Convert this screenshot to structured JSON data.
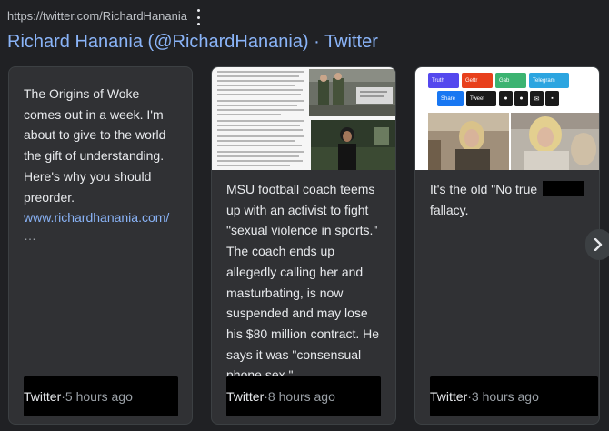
{
  "result": {
    "url": "https://twitter.com/RichardHanania",
    "title": "Richard Hanania (@RichardHanania) · Twitter"
  },
  "cards": [
    {
      "text_lines": [
        "The Origins of Woke",
        "comes out in a week. I'm",
        "about to give to the world",
        "the gift of understanding.",
        "Here's why you should",
        "preorder."
      ],
      "link": "www.richardhanania.com/",
      "ellipsis": "…",
      "source": "Twitter",
      "time": "5 hours ago"
    },
    {
      "text_lines": [
        "MSU football coach teems",
        "up with an activist to fight",
        "\"sexual violence in sports.\"",
        "The coach ends up",
        "allegedly calling her and",
        "masturbating, is now",
        "suspended and may lose",
        "his $80 million contract. He",
        "says it was \"consensual",
        "phone sex.\""
      ],
      "source": "Twitter",
      "time": "8 hours ago"
    },
    {
      "text_lines": [
        "It's the old \"No true",
        "fallacy."
      ],
      "source": "Twitter",
      "time": "3 hours ago",
      "share_buttons": [
        {
          "label": "Truth",
          "color": "#5448ee"
        },
        {
          "label": "Gettr",
          "color": "#e8401c"
        },
        {
          "label": "Gab",
          "color": "#3cb371"
        },
        {
          "label": "Telegram",
          "color": "#2ca5e0"
        },
        {
          "label": "Share",
          "color": "#1877f2"
        },
        {
          "label": "Tweet",
          "color": "#1a1a1a"
        }
      ]
    }
  ],
  "separator": " · ",
  "icons": {
    "menu": "more-vert-icon",
    "next": "chevron-right-icon"
  }
}
